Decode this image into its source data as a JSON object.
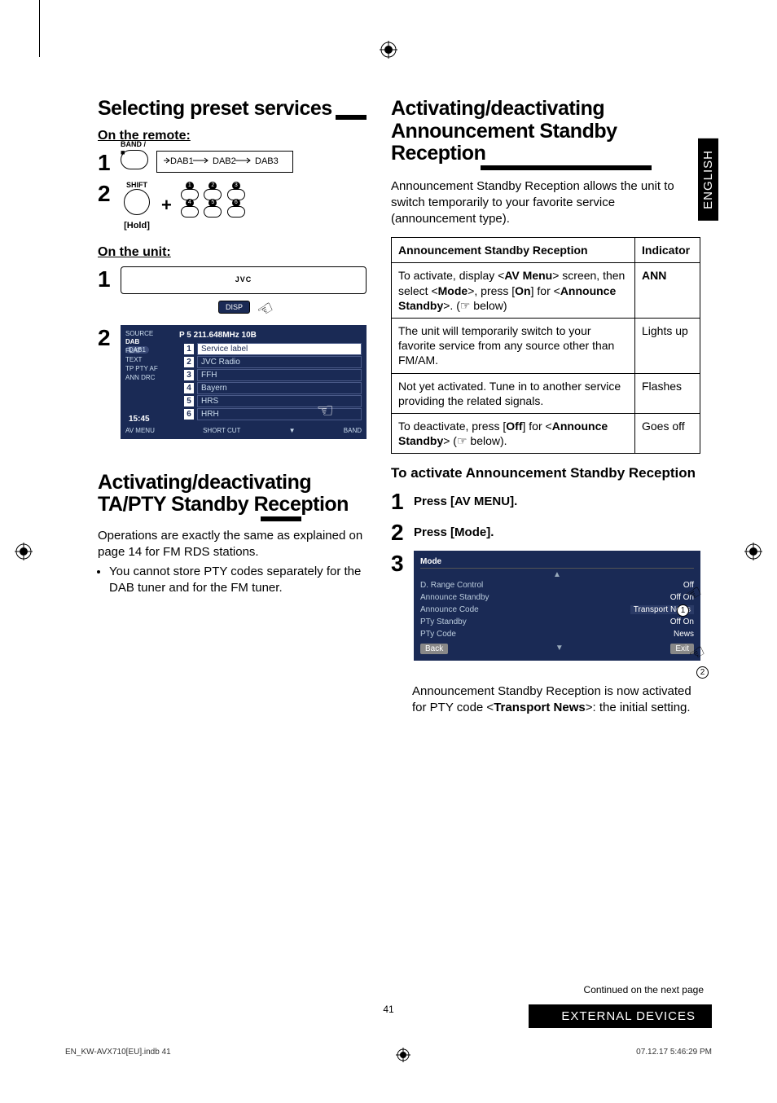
{
  "lang_tab": "ENGLISH",
  "left": {
    "section1_title": "Selecting preset services",
    "on_remote": "On the remote:",
    "on_unit": "On the unit:",
    "step1": "1",
    "step2": "2",
    "dab_chain": "DAB1 → DAB2 → DAB3",
    "band_label": "BAND / ■",
    "shift_label": "SHIFT",
    "hold_label": "[Hold]",
    "jvc": "JVC",
    "disp": "DISP",
    "screen": {
      "source": "SOURCE",
      "dab": "DAB",
      "dab1": "DAB1",
      "flat": "FLAT",
      "text": "TEXT",
      "tp_pty_af": "TP  PTY  AF",
      "ann_drc": "ANN   DRC",
      "time": "15:45",
      "av_menu": "AV MENU",
      "short_cut": "SHORT CUT",
      "band": "BAND",
      "header": "P 5      211.648MHz     10B",
      "rows": [
        {
          "n": "1",
          "label": "Service label"
        },
        {
          "n": "2",
          "label": "JVC Radio"
        },
        {
          "n": "3",
          "label": "FFH"
        },
        {
          "n": "4",
          "label": "Bayern"
        },
        {
          "n": "5",
          "label": "HRS"
        },
        {
          "n": "6",
          "label": "HRH"
        }
      ]
    },
    "section2_title": "Activating/deactivating TA/PTY Standby Reception",
    "section2_body": "Operations are exactly the same as explained on page 14 for FM RDS stations.",
    "section2_bullet": "You cannot store PTY codes separately for the DAB tuner and for the FM tuner."
  },
  "right": {
    "section_title": "Activating/deactivating Announcement Standby Reception",
    "intro": "Announcement Standby Reception allows the unit to switch temporarily to your favorite service (announcement type).",
    "table": {
      "h1": "Announcement Standby Reception",
      "h2": "Indicator",
      "r1a_pre": "To activate, display <",
      "r1a_avmenu": "AV Menu",
      "r1a_mid1": "> screen, then select <",
      "r1a_mode": "Mode",
      "r1a_mid2": ">, press [",
      "r1a_on": "On",
      "r1a_mid3": "] for <",
      "r1a_announce": "Announce Standby",
      "r1a_tail": ">. (☞ below)",
      "r1b": "ANN",
      "r2a": "The unit will temporarily switch to your favorite service from any source other than FM/AM.",
      "r2b": "Lights up",
      "r3a": "Not yet activated. Tune in to another service providing the related signals.",
      "r3b": "Flashes",
      "r4a_pre": "To deactivate, press [",
      "r4a_off": "Off",
      "r4a_mid": "] for <",
      "r4a_announce": "Announce Standby",
      "r4a_tail": "> (☞ below).",
      "r4b": "Goes off"
    },
    "subtitle": "To activate Announcement Standby Reception",
    "step1_num": "1",
    "step1_text": "Press [AV MENU].",
    "step2_num": "2",
    "step2_text": "Press [Mode].",
    "step3_num": "3",
    "mode_screen": {
      "title": "Mode",
      "rows": [
        {
          "label": "D. Range Control",
          "val": "Off"
        },
        {
          "label": "Announce Standby",
          "val": "Off    On"
        },
        {
          "label": "Announce Code",
          "val": "Transport News"
        },
        {
          "label": "PTy Standby",
          "val": "Off    On"
        },
        {
          "label": "PTy Code",
          "val": "News"
        }
      ],
      "back": "Back",
      "exit": "Exit"
    },
    "after_pre": "Announcement Standby Reception is now activated for PTY code <",
    "after_bold": "Transport News",
    "after_tail": ">: the initial setting."
  },
  "footer": {
    "continued": "Continued on the next page",
    "extbar": "EXTERNAL DEVICES",
    "pagenum": "41",
    "indb": "EN_KW-AVX710[EU].indb   41",
    "timestamp": "07.12.17   5:46:29 PM"
  }
}
